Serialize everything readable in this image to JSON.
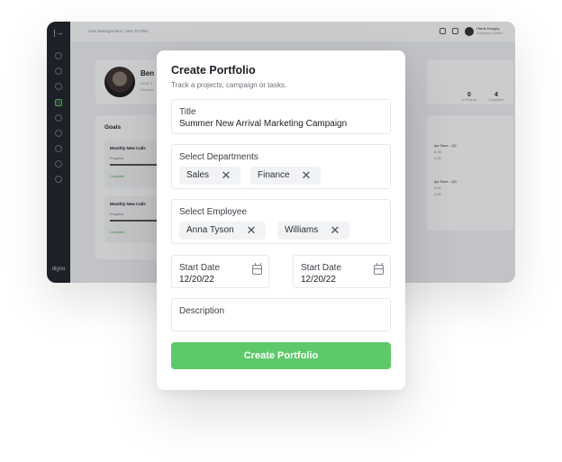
{
  "background_app": {
    "logo": "digno",
    "breadcrumb": "User Management / User Profiles",
    "user": {
      "name": "Harris Dongey",
      "role": "Company Admin"
    },
    "profile": {
      "name": "Ben",
      "line1": "fGHE-3",
      "line2": "Finance"
    },
    "goals": {
      "title": "Goals",
      "items": [
        {
          "name": "Monthly New Calls",
          "progress_label": "Progress",
          "status": "Complete"
        },
        {
          "name": "Monthly New Calls",
          "progress_label": "Progress",
          "status": "Complete"
        }
      ]
    },
    "stats": [
      {
        "value": "0",
        "label": "In Projects"
      },
      {
        "value": "4",
        "label": "Completed"
      }
    ],
    "stores": [
      {
        "name": "lya Store - Q2",
        "a": "0.00",
        "b": "0.00"
      },
      {
        "name": "lya Store - Q3",
        "a": "0.00",
        "b": "0.00"
      }
    ]
  },
  "modal": {
    "title": "Create Portfolio",
    "subtitle": "Track a projects, campaign or tasks.",
    "title_field": {
      "label": "Title",
      "value": "Summer New Arrival Marketing Campaign"
    },
    "departments": {
      "label": "Select Departments",
      "chips": [
        "Sales",
        "Finance"
      ]
    },
    "employees": {
      "label": "Select Employee",
      "chips": [
        "Anna Tyson",
        "Williams"
      ]
    },
    "start_date_1": {
      "label": "Start Date",
      "value": "12/20/22"
    },
    "start_date_2": {
      "label": "Start Date",
      "value": "12/20/22"
    },
    "description": {
      "label": "Description",
      "value": ""
    },
    "submit_label": "Create Portfolio",
    "remove_glyph": "✕"
  },
  "colors": {
    "accent": "#5ec96a",
    "sidebar": "#20242a"
  }
}
